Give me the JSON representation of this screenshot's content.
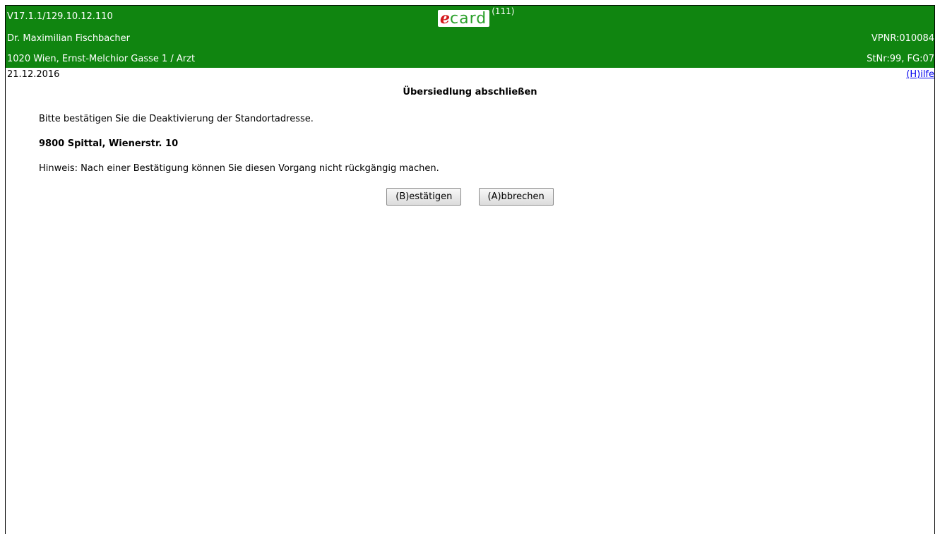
{
  "header": {
    "version": "V17.1.1/129.10.12.110",
    "logo": {
      "e": "e",
      "card": "card",
      "code": "(111)"
    },
    "doctor_name": "Dr. Maximilian Fischbacher",
    "vpnr": "VPNR:010084",
    "address_role": "1020 Wien, Ernst-Melchior Gasse 1 / Arzt",
    "station": "StNr:99, FG:07",
    "background_color": "#108510"
  },
  "subheader": {
    "date": "21.12.2016",
    "help_link": "(H)ilfe"
  },
  "main": {
    "title": "Übersiedlung abschließen",
    "confirm_text": "Bitte bestätigen Sie die Deaktivierung der Standortadresse.",
    "address": "9800 Spittal, Wienerstr. 10",
    "hint": "Hinweis: Nach einer Bestätigung können Sie diesen Vorgang nicht rückgängig machen.",
    "confirm_button": "(B)estätigen",
    "cancel_button": "(A)bbrechen"
  }
}
